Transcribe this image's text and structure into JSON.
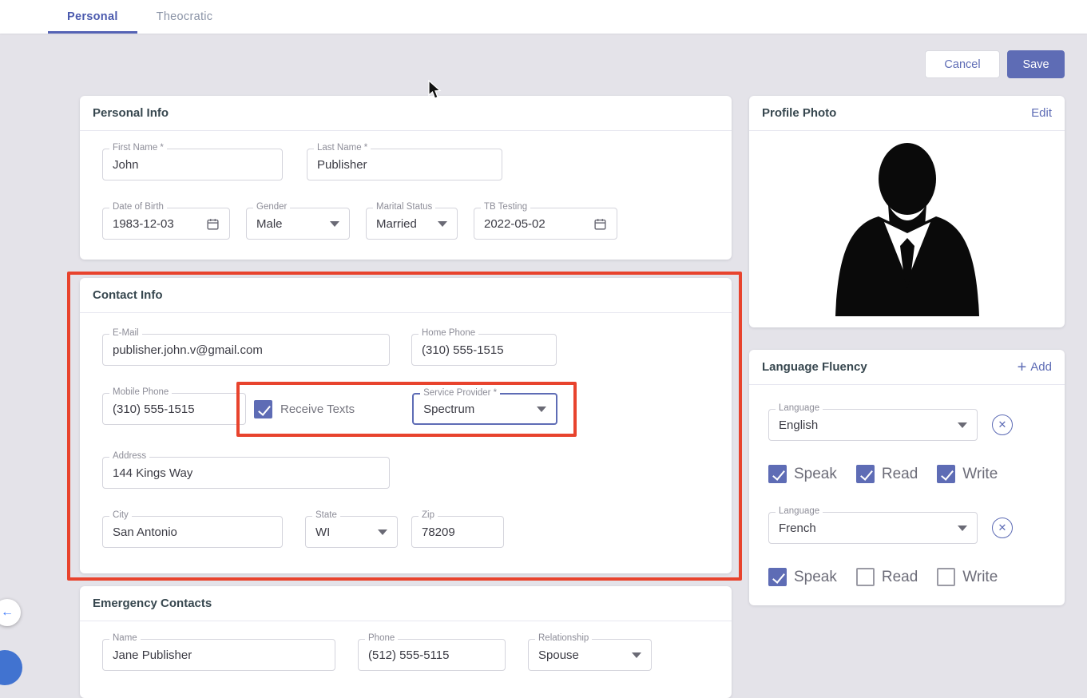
{
  "colors": {
    "accent": "#5e6cb5",
    "highlight_red": "#e8432d",
    "background": "#e4e3e9",
    "tab_active": "#4b5aae"
  },
  "tabs": {
    "personal": "Personal",
    "theocratic": "Theocratic"
  },
  "actions": {
    "cancel": "Cancel",
    "save": "Save"
  },
  "personal_info": {
    "title": "Personal Info",
    "first_name": {
      "label": "First Name *",
      "value": "John"
    },
    "last_name": {
      "label": "Last Name *",
      "value": "Publisher"
    },
    "date_of_birth": {
      "label": "Date of Birth",
      "value": "1983-12-03"
    },
    "gender": {
      "label": "Gender",
      "value": "Male"
    },
    "marital_status": {
      "label": "Marital Status",
      "value": "Married"
    },
    "tb_testing": {
      "label": "TB Testing",
      "value": "2022-05-02"
    }
  },
  "contact_info": {
    "title": "Contact Info",
    "email": {
      "label": "E-Mail",
      "value": "publisher.john.v@gmail.com"
    },
    "home_phone": {
      "label": "Home Phone",
      "value": "(310) 555-1515"
    },
    "mobile_phone": {
      "label": "Mobile Phone",
      "value": "(310) 555-1515"
    },
    "receive_texts": {
      "label": "Receive Texts",
      "checked": true
    },
    "service_provider": {
      "label": "Service Provider *",
      "value": "Spectrum"
    },
    "address": {
      "label": "Address",
      "value": "144 Kings Way"
    },
    "city": {
      "label": "City",
      "value": "San Antonio"
    },
    "state": {
      "label": "State",
      "value": "WI"
    },
    "zip": {
      "label": "Zip",
      "value": "78209"
    }
  },
  "emergency_contacts": {
    "title": "Emergency Contacts",
    "name": {
      "label": "Name",
      "value": "Jane Publisher"
    },
    "phone": {
      "label": "Phone",
      "value": "(512) 555-5115"
    },
    "relationship": {
      "label": "Relationship",
      "value": "Spouse"
    }
  },
  "profile_photo": {
    "title": "Profile Photo",
    "edit_label": "Edit"
  },
  "language_fluency": {
    "title": "Language Fluency",
    "add_label": "Add",
    "skill_labels": {
      "speak": "Speak",
      "read": "Read",
      "write": "Write"
    },
    "entries": [
      {
        "language": {
          "label": "Language",
          "value": "English"
        },
        "speak": true,
        "read": true,
        "write": true
      },
      {
        "language": {
          "label": "Language",
          "value": "French"
        },
        "speak": true,
        "read": false,
        "write": false
      }
    ]
  }
}
